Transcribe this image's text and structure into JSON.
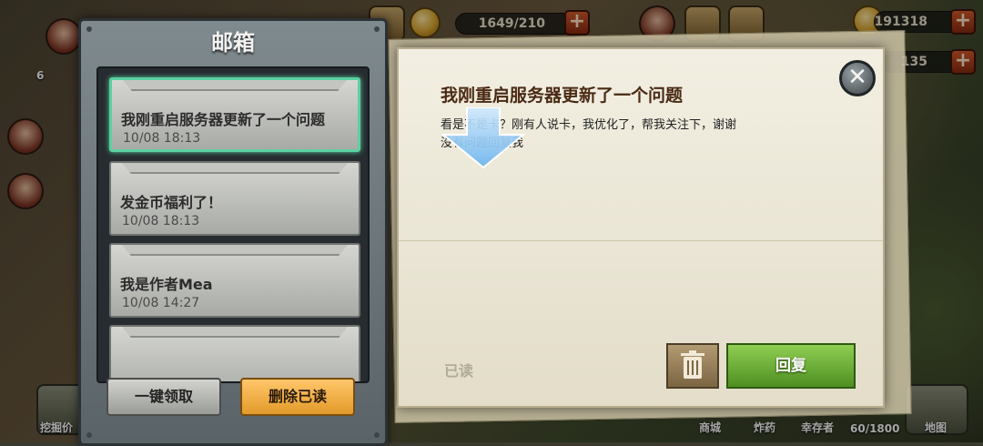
{
  "hud": {
    "energy": "1649/210",
    "gold": "191318",
    "gems": "135",
    "left_level": "6"
  },
  "bottom": {
    "dig_label": "挖掘价",
    "shop_label": "商城",
    "bomb_label": "炸药",
    "survivor_label": "幸存者",
    "capacity_label": "60/1800",
    "map_label": "地图"
  },
  "mailbox": {
    "title": "邮箱",
    "claim_all": "一键领取",
    "delete_read": "删除已读",
    "items": [
      {
        "subject": "我刚重启服务器更新了一个问题",
        "date": "10/08 18:13",
        "selected": true
      },
      {
        "subject": "发金币福利了！",
        "date": "10/08 18:13",
        "selected": false
      },
      {
        "subject": "我是作者Mea",
        "date": "10/08 14:27",
        "selected": false
      }
    ]
  },
  "letter": {
    "title": "我刚重启服务器更新了一个问题",
    "body_line1": "看是不是卡？刚有人说卡，我优化了，帮我关注下，谢谢",
    "body_line2": "没有问题回复我",
    "status": "已读",
    "reply": "回复",
    "close_symbol": "✕"
  },
  "icons": [
    "mail-icon",
    "coin-icon",
    "plus-icon",
    "avatar-icon",
    "trash-icon",
    "close-icon",
    "arrow-down-icon"
  ]
}
